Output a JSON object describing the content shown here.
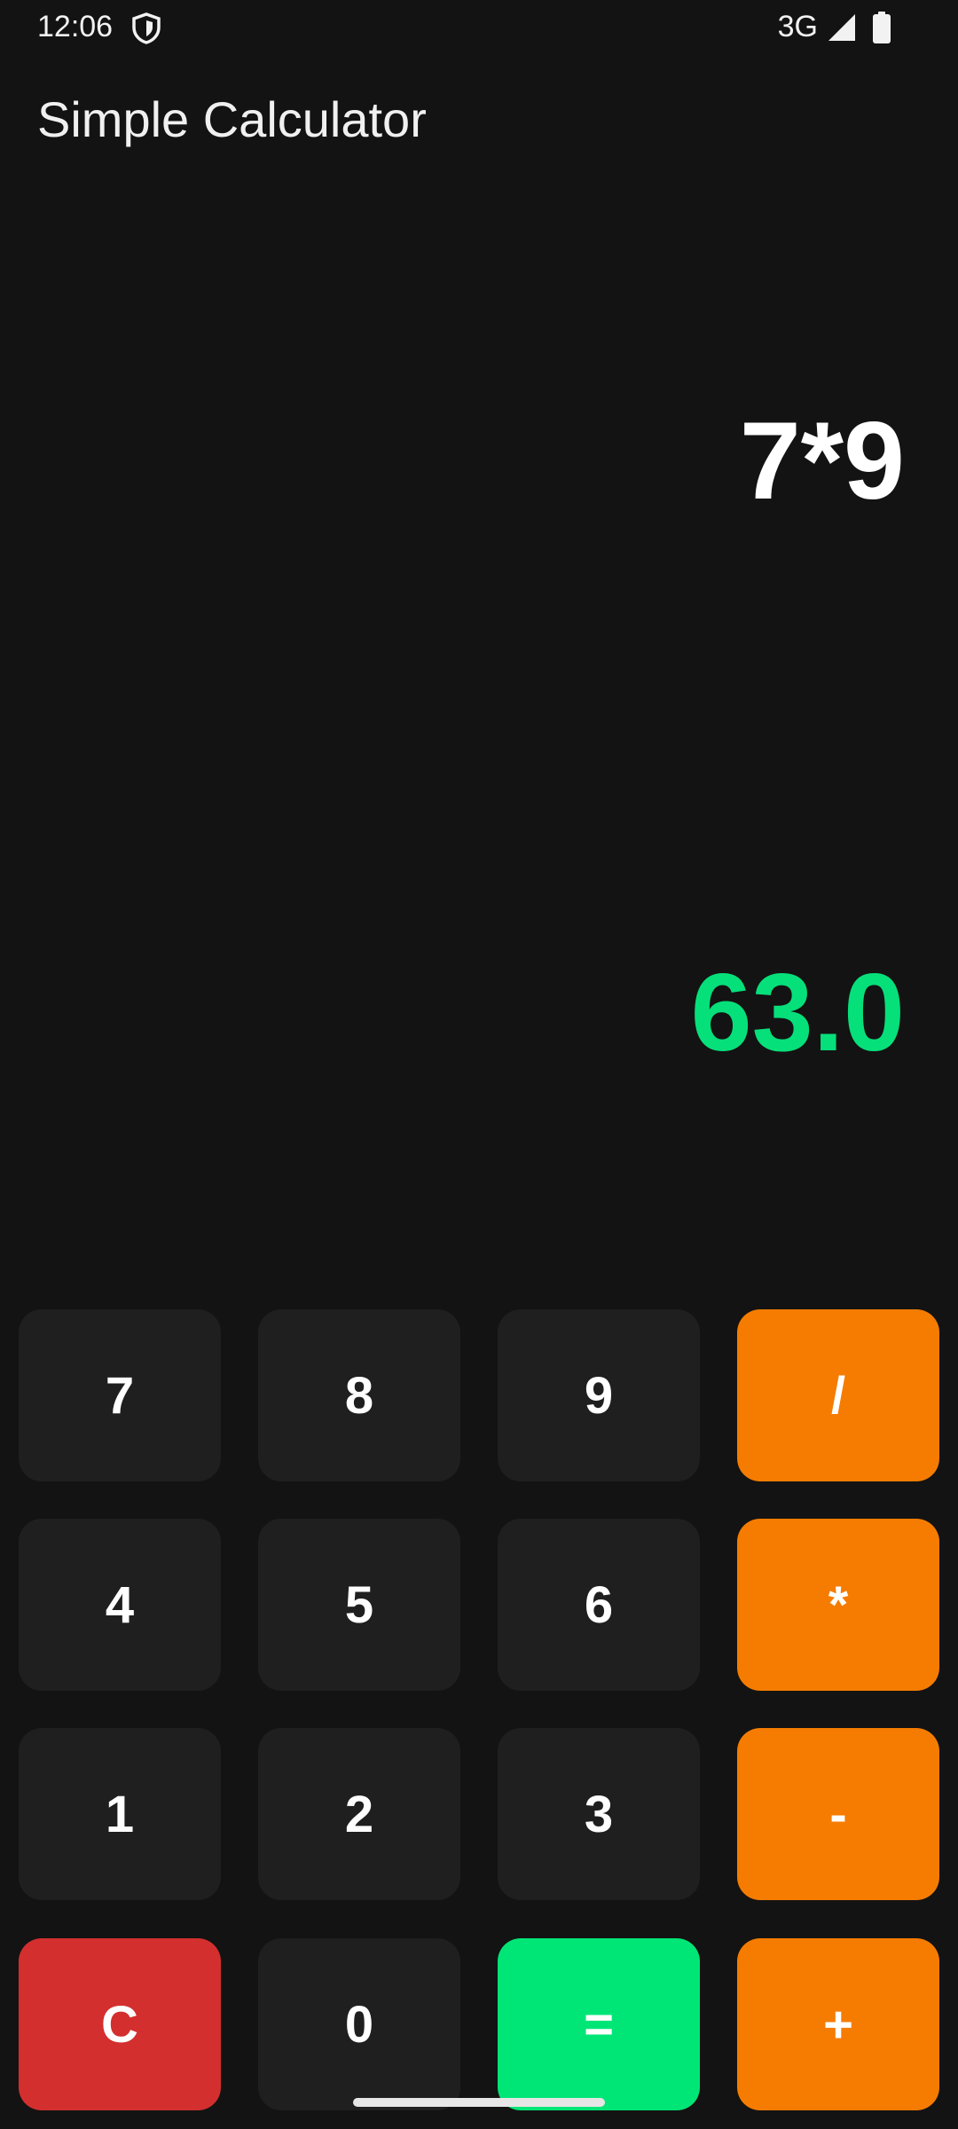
{
  "status_bar": {
    "time": "12:06",
    "network": "3G",
    "icons": [
      "shield-icon",
      "signal-icon",
      "battery-icon"
    ]
  },
  "app": {
    "title": "Simple Calculator"
  },
  "display": {
    "expression": "7*9",
    "result": "63.0",
    "result_color": "#06e07a"
  },
  "keypad": {
    "rows": [
      [
        "7",
        "8",
        "9",
        "/"
      ],
      [
        "4",
        "5",
        "6",
        "*"
      ],
      [
        "1",
        "2",
        "3",
        "-"
      ],
      [
        "C",
        "0",
        "=",
        "+"
      ]
    ],
    "colors": {
      "digit": "#1f1f1f",
      "operator": "#f57c00",
      "clear": "#d32f2f",
      "equals": "#00e676"
    }
  }
}
